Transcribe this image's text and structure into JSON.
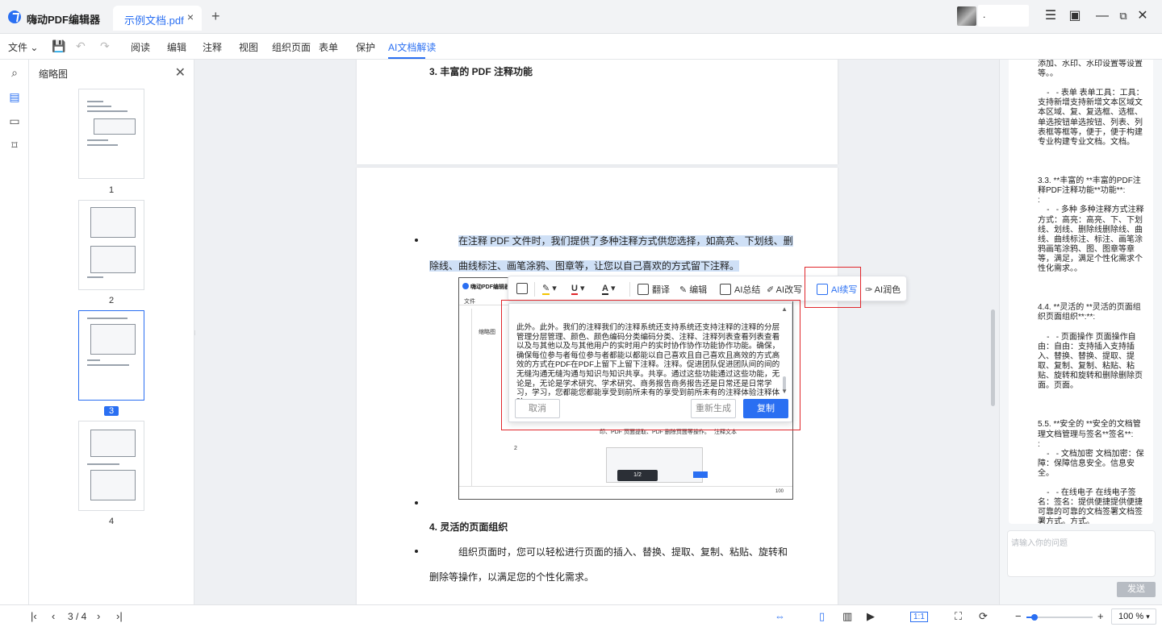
{
  "titlebar": {
    "app_name": "嗨动PDF编辑器",
    "tab_label": "示例文档.pdf",
    "tab_close": "×",
    "new_tab": "+",
    "user_name": "."
  },
  "menubar": {
    "file": "文件",
    "items": [
      "阅读",
      "编辑",
      "注释",
      "视图",
      "组织页面",
      "表单",
      "保护",
      "AI文档解读"
    ],
    "active_index": 7
  },
  "thumbnails": {
    "title": "缩略图",
    "pages": [
      "1",
      "2",
      "3",
      "4"
    ],
    "active_page": "3"
  },
  "document": {
    "heading3": "3. 丰富的 PDF 注释功能",
    "para1_line1": "在注释 PDF 文件时，我们提供了多种注释方式供您选择，如高亮、下划线、删",
    "para1_line2": "除线、曲线标注、画笔涂鸦、图章等，让您以自己喜欢的方式留下注释。",
    "heading4": "4. 灵活的页面组织",
    "para2_line1": "组织页面时，您可以轻松进行页面的插入、替换、提取、复制、粘贴、旋转和",
    "para2_line2": "删除等操作，以满足您的个性化需求。",
    "embed": {
      "title": "嗨动PDF编辑器",
      "file": "文件",
      "thumbs": "缩略图",
      "caption": "印、PDF 页面提取、PDF 删除页面等操作。",
      "caption2": "注释文本",
      "num": "2",
      "pager": "1/2",
      "zoom": "100"
    }
  },
  "float_toolbar": {
    "translate": "翻译",
    "edit": "编辑",
    "summary": "AI总结",
    "rewrite": "AI改写",
    "continue": "AI续写",
    "polish": "AI润色"
  },
  "ai_result": {
    "text": "此外。此外。我们的注释我们的注释系统还支持系统还支持注释的注释的分层管理分层管理、颜色、颜色编码分类编码分类、注释、注释列表查看列表查看以及与其他以及与其他用户的实时用户的实时协作协作功能协作功能。确保，确保每位参与者每位参与者都能以都能以自己喜欢且自己喜欢且高效的方式高效的方式在PDF在PDF上留下上留下注释。注释。促进团队促进团队间的间的无缝沟通无缝沟通与知识与知识共享。共享。通过这些功能通过这些功能，无论是，无论是学术研究、学术研究、商务报告商务报告还是日常还是日常学习，学习，您都能您都能享受到前所未有的享受到前所未有的注释体验注释体验。。",
    "cancel": "取消",
    "regenerate": "重新生成",
    "copy": "复制"
  },
  "chat": {
    "content": "添加、水印、水印设置等设置等。。\n\n    -   - 表单 表单工具：工具：支持新增支持新增文本区域文本区域、复、复选框、选框、单选按钮单选按钮、列表、列表框等框等，便于，便于构建专业构建专业文档。文档。\n\n\n\n3.3. **丰富的 **丰富的PDF注释PDF注释功能**功能**:\n:\n    -   - 多种 多种注释方式注释方式：高亮：高亮、下、下划线、划线、删除线删除线、曲线、曲线标注、标注、画笔涂鸦画笔涂鸦、图、图章等章等，满足，满足个性化需求个性化需求。。\n\n\n\n4.4. **灵活的 **灵活的页面组织页面组织**:**:\n\n    -   - 页面操作 页面操作自由：自由：支持插入支持插入、替换、替换、提取、提取、复制、复制、粘贴、粘贴、旋转和旋转和删除删除页面。页面。\n\n\n\n5.5. **安全的 **安全的文档管理文档管理与签名**签名**:\n:\n    -   - 文档加密 文档加密：保障：保障信息安全。信息安全。\n\n    -   - 在线电子 在线电子签名：签名：提供便捷提供便捷可靠的可靠的文档签署文档签署方式。方式。",
    "placeholder": "请输入你的问题",
    "send": "发送"
  },
  "statusbar": {
    "page_indicator": "3 / 4",
    "fit_ratio": "1:1",
    "zoom": "100 %",
    "zoom_fraction": 0.12
  }
}
